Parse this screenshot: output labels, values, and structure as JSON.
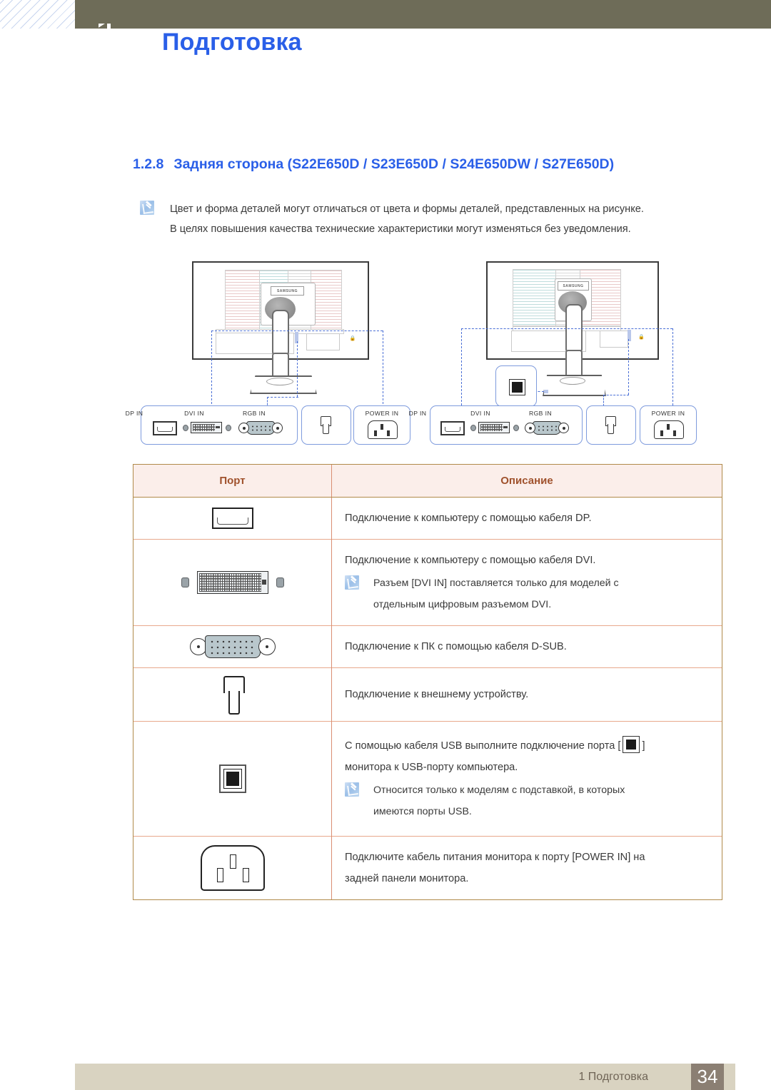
{
  "header": {
    "title": "Подготовка"
  },
  "section": {
    "number": "1.2.8",
    "title": "Задняя сторона (S22E650D / S23E650D / S24E650DW / S27E650D)"
  },
  "intro_note": {
    "icon": "note-icon",
    "lines": [
      "Цвет и форма деталей могут отличаться от цвета и формы деталей, представленных на рисунке.",
      "В целях повышения качества технические характеристики могут изменяться без уведомления."
    ]
  },
  "diagrams": {
    "left": {
      "logo": "SAMSUNG",
      "callouts": {
        "dp": "DP IN",
        "dvi": "DVI IN",
        "rgb": "RGB IN",
        "headphone": "",
        "power": "POWER IN"
      }
    },
    "right": {
      "logo": "SAMSUNG",
      "callouts": {
        "usb": "",
        "dp": "DP IN",
        "dvi": "DVI IN",
        "rgb": "RGB IN",
        "headphone": "",
        "power": "POWER IN"
      }
    }
  },
  "table": {
    "headers": {
      "port": "Порт",
      "description": "Описание"
    },
    "rows": [
      {
        "icon": "dp-port-icon",
        "text": "Подключение к компьютеру с помощью кабеля DP.",
        "note": null
      },
      {
        "icon": "dvi-port-icon",
        "text": "Подключение к компьютеру с помощью кабеля DVI.",
        "note": [
          "Разъем [DVI IN] поставляется только для моделей с",
          "отдельным цифровым разъемом DVI."
        ]
      },
      {
        "icon": "vga-dsub-port-icon",
        "text": "Подключение к ПК с помощью кабеля D-SUB.",
        "note": null
      },
      {
        "icon": "headphone-port-icon",
        "text": "Подключение к внешнему устройству.",
        "note": null
      },
      {
        "icon": "usb-port-icon",
        "text_parts": {
          "before": "С помощью кабеля USB выполните подключение порта [",
          "after": "]",
          "line2": "монитора к USB-порту компьютера."
        },
        "note": [
          "Относится только к моделям с подставкой, в которых",
          "имеются порты USB."
        ]
      },
      {
        "icon": "power-in-port-icon",
        "text_lines": [
          "Подключите кабель питания монитора к порту [POWER IN] на",
          "задней панели монитора."
        ],
        "note": null
      }
    ]
  },
  "footer": {
    "chapter": "1 Подготовка",
    "page": "34"
  },
  "colors": {
    "header_bar": "#6e6c58",
    "title_blue": "#2a5fe8",
    "table_border": "#b08a4a",
    "table_header_bg": "#fbeeea",
    "table_header_text": "#a0522d",
    "row_divider": "#e8a98c",
    "footer_bar": "#d9d3c1",
    "footer_page_bg": "#8b7f73",
    "callout_border": "#7e9bdd",
    "dash_blue": "#4a6fd6"
  }
}
